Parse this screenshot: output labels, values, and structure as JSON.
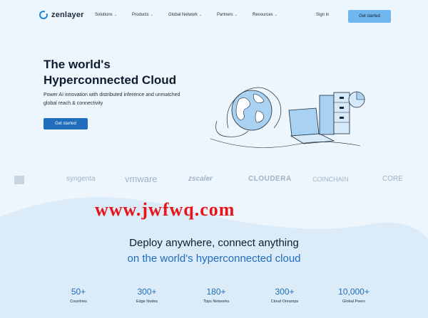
{
  "nav": {
    "logo_text": "zenlayer",
    "menu": [
      {
        "label": "Solutions"
      },
      {
        "label": "Products"
      },
      {
        "label": "Global Network"
      },
      {
        "label": "Partners"
      },
      {
        "label": "Resources"
      }
    ],
    "signin": "Sign in",
    "cta": "Get started"
  },
  "hero": {
    "title_line1": "The world's",
    "title_line2": "Hyperconnected Cloud",
    "subtitle_line1": "Power AI innovation with distributed inference and unmatched",
    "subtitle_line2": "global reach & connectivity",
    "cta": "Get started"
  },
  "logos": [
    "syngenta",
    "vmware",
    "zscaler",
    "CLOUDERA",
    "COINCHAIN",
    "CORE"
  ],
  "watermark": "www.jwfwq.com",
  "deploy": {
    "line1": "Deploy anywhere, connect anything",
    "line2": "on the world's hyperconnected cloud"
  },
  "stats": [
    {
      "num": "50+",
      "label": "Countries"
    },
    {
      "num": "300+",
      "label": "Edge Nodes"
    },
    {
      "num": "180+",
      "label": "Tbps Networks"
    },
    {
      "num": "300+",
      "label": "Cloud Onramps"
    },
    {
      "num": "10,000+",
      "label": "Global Peers"
    }
  ],
  "colors": {
    "accent": "#1f6dbb",
    "cta_light": "#6fb7ee",
    "background": "#eef6fd",
    "watermark": "#e8141a"
  }
}
